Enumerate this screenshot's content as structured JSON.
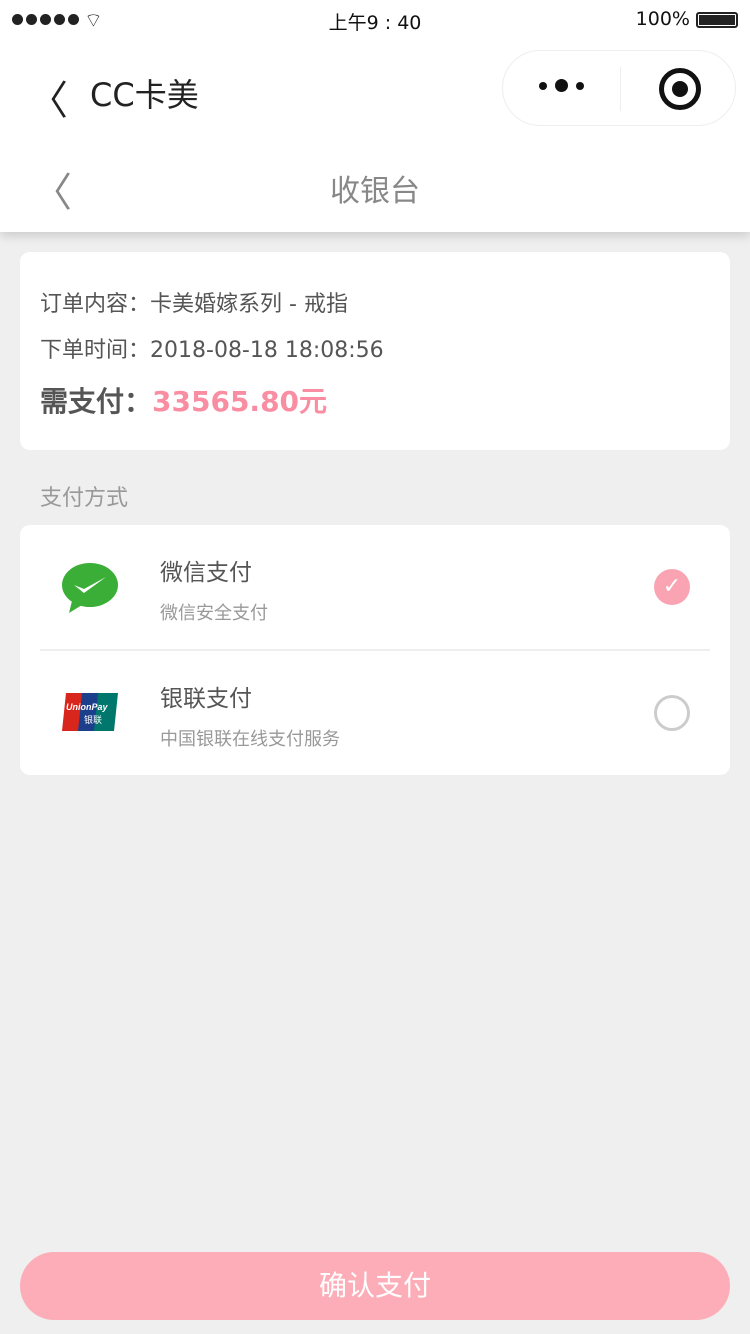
{
  "status_bar": {
    "time": "上午9 : 40",
    "battery": "100%"
  },
  "app_bar": {
    "title": "CC卡美"
  },
  "page": {
    "title": "收银台"
  },
  "order": {
    "content_label": "订单内容：",
    "content_value": "卡美婚嫁系列 - 戒指",
    "time_label": "下单时间：",
    "time_value": "2018-08-18 18:08:56",
    "pay_label": "需支付：",
    "pay_amount": "33565.80元"
  },
  "payment_section": {
    "title": "支付方式",
    "methods": [
      {
        "name": "微信支付",
        "desc": "微信安全支付",
        "selected": true
      },
      {
        "name": "银联支付",
        "desc": "中国银联在线支付服务",
        "selected": false,
        "logo_text": "UnionPay 银联"
      }
    ]
  },
  "confirm_label": "确认支付",
  "colors": {
    "accent": "#f98ea2",
    "button": "#fdadb8",
    "wechat": "#3aae37"
  }
}
